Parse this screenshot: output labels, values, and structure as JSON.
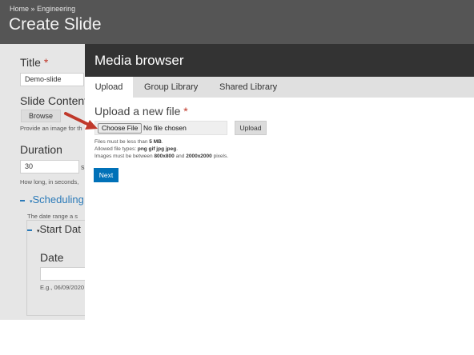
{
  "header": {
    "breadcrumb": {
      "home": "Home",
      "separator": "»",
      "section": "Engineering"
    },
    "title": "Create Slide"
  },
  "background_form": {
    "title_label": "Title",
    "required_mark": "*",
    "title_value": "Demo-slide",
    "slide_content_label": "Slide Content",
    "browse_label": "Browse",
    "provide_image_help": "Provide an image for th",
    "duration_label": "Duration",
    "duration_value": "30",
    "duration_suffix": "s",
    "duration_help": "How long, in seconds,",
    "scheduling_link": "Scheduling",
    "date_range_text": "The date range a s",
    "start_date_legend": "Start Dat",
    "date_label": "Date",
    "date_help": "E.g., 06/09/2020"
  },
  "modal": {
    "title": "Media browser",
    "tabs": [
      {
        "label": "Upload",
        "active": true
      },
      {
        "label": "Group Library",
        "active": false
      },
      {
        "label": "Shared Library",
        "active": false
      }
    ],
    "upload_heading": "Upload a new file",
    "required_mark": "*",
    "choose_file_label": "Choose File",
    "no_file_text": "No file chosen",
    "upload_button": "Upload",
    "help": {
      "size_prefix": "Files must be less than",
      "size_value": "5 MB",
      "size_suffix": ".",
      "types_prefix": "Allowed file types:",
      "types_value": "png gif jpg jpeg",
      "types_suffix": ".",
      "dims_prefix": "Images must be between",
      "dims_min": "800x800",
      "dims_and": "and",
      "dims_max": "2000x2000",
      "dims_suffix": "pixels."
    },
    "next_button": "Next"
  },
  "colors": {
    "header_bg": "#555555",
    "modal_titlebar": "#333333",
    "tabs_bg": "#e0e0e0",
    "accent_blue": "#0071b8",
    "link_blue": "#2b7ab8",
    "required_red": "#c0392b",
    "annotation_arrow": "#c0392b"
  },
  "icons": {
    "collapse_marker": "triangle-down-icon",
    "annotation": "red-arrow-icon"
  }
}
